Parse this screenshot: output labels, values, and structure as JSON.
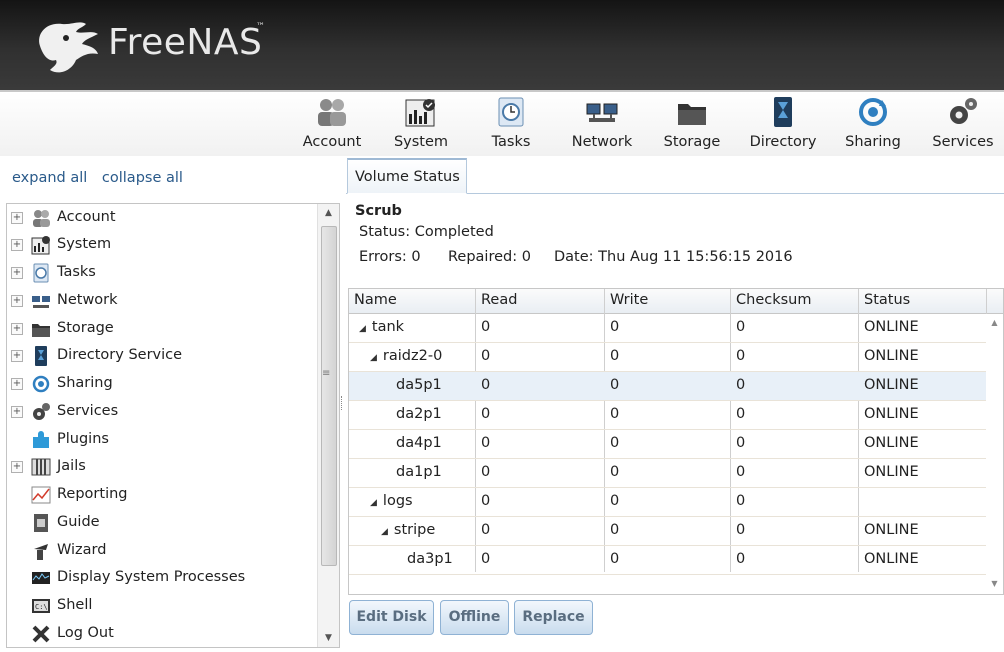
{
  "app": {
    "title": "FreeNAS",
    "tm": "™"
  },
  "toolbar": [
    {
      "label": "Account",
      "icon": "account-icon"
    },
    {
      "label": "System",
      "icon": "system-icon"
    },
    {
      "label": "Tasks",
      "icon": "tasks-icon"
    },
    {
      "label": "Network",
      "icon": "network-icon"
    },
    {
      "label": "Storage",
      "icon": "storage-icon"
    },
    {
      "label": "Directory",
      "icon": "directory-icon"
    },
    {
      "label": "Sharing",
      "icon": "sharing-icon"
    },
    {
      "label": "Services",
      "icon": "services-icon"
    }
  ],
  "sidebar": {
    "expand_all": "expand all",
    "collapse_all": "collapse all",
    "items": [
      {
        "label": "Account",
        "expandable": true,
        "icon": "account-icon"
      },
      {
        "label": "System",
        "expandable": true,
        "icon": "system-icon"
      },
      {
        "label": "Tasks",
        "expandable": true,
        "icon": "tasks-icon"
      },
      {
        "label": "Network",
        "expandable": true,
        "icon": "network-icon"
      },
      {
        "label": "Storage",
        "expandable": true,
        "icon": "storage-icon"
      },
      {
        "label": "Directory Service",
        "expandable": true,
        "icon": "directory-icon"
      },
      {
        "label": "Sharing",
        "expandable": true,
        "icon": "sharing-icon"
      },
      {
        "label": "Services",
        "expandable": true,
        "icon": "services-icon"
      },
      {
        "label": "Plugins",
        "expandable": false,
        "icon": "plugins-icon"
      },
      {
        "label": "Jails",
        "expandable": true,
        "icon": "jails-icon"
      },
      {
        "label": "Reporting",
        "expandable": false,
        "icon": "reporting-icon"
      },
      {
        "label": "Guide",
        "expandable": false,
        "icon": "guide-icon"
      },
      {
        "label": "Wizard",
        "expandable": false,
        "icon": "wizard-icon"
      },
      {
        "label": "Display System Processes",
        "expandable": false,
        "icon": "processes-icon"
      },
      {
        "label": "Shell",
        "expandable": false,
        "icon": "shell-icon"
      },
      {
        "label": "Log Out",
        "expandable": false,
        "icon": "logout-icon"
      }
    ]
  },
  "main": {
    "tab_label": "Volume Status",
    "scrub": {
      "title": "Scrub",
      "status": "Status: Completed",
      "errors": "Errors: 0",
      "repaired": "Repaired: 0",
      "date": "Date: Thu Aug 11 15:56:15 2016"
    },
    "table": {
      "columns": [
        "Name",
        "Read",
        "Write",
        "Checksum",
        "Status"
      ],
      "rows": [
        {
          "name": "tank",
          "read": "0",
          "write": "0",
          "checksum": "0",
          "status": "ONLINE",
          "level": 0,
          "expanded": true
        },
        {
          "name": "raidz2-0",
          "read": "0",
          "write": "0",
          "checksum": "0",
          "status": "ONLINE",
          "level": 1,
          "expanded": true
        },
        {
          "name": "da5p1",
          "read": "0",
          "write": "0",
          "checksum": "0",
          "status": "ONLINE",
          "level": 2,
          "selected": true
        },
        {
          "name": "da2p1",
          "read": "0",
          "write": "0",
          "checksum": "0",
          "status": "ONLINE",
          "level": 2
        },
        {
          "name": "da4p1",
          "read": "0",
          "write": "0",
          "checksum": "0",
          "status": "ONLINE",
          "level": 2
        },
        {
          "name": "da1p1",
          "read": "0",
          "write": "0",
          "checksum": "0",
          "status": "ONLINE",
          "level": 2
        },
        {
          "name": "logs",
          "read": "0",
          "write": "0",
          "checksum": "0",
          "status": "",
          "level": 1,
          "expanded": true
        },
        {
          "name": "stripe",
          "read": "0",
          "write": "0",
          "checksum": "0",
          "status": "ONLINE",
          "level": 2,
          "expanded": true
        },
        {
          "name": "da3p1",
          "read": "0",
          "write": "0",
          "checksum": "0",
          "status": "ONLINE",
          "level": 3
        }
      ]
    },
    "buttons": {
      "edit_disk": "Edit Disk",
      "offline": "Offline",
      "replace": "Replace"
    }
  },
  "colors": {
    "accent": "#2a5a8a",
    "header_dark": "#1a1a1a",
    "selected_row": "#e8f0f8"
  }
}
